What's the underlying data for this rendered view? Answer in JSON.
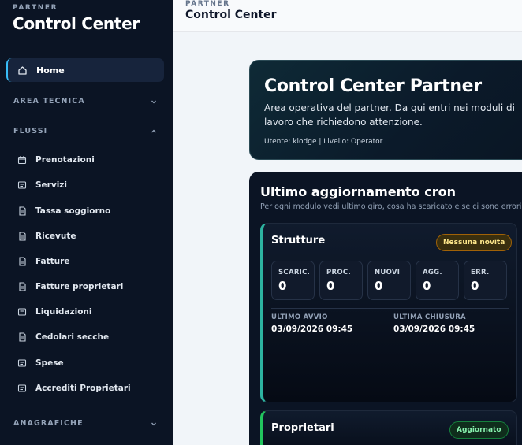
{
  "sidebar": {
    "kicker": "PARTNER",
    "title": "Control Center",
    "home": "Home",
    "sections": {
      "tecnica": "AREA TECNICA",
      "flussi": "FLUSSI",
      "anagrafiche": "ANAGRAFICHE"
    },
    "items": [
      {
        "label": "Prenotazioni",
        "icon": "calendar-icon"
      },
      {
        "label": "Servizi",
        "icon": "receipt-icon"
      },
      {
        "label": "Tassa soggiorno",
        "icon": "document-icon"
      },
      {
        "label": "Ricevute",
        "icon": "document-icon"
      },
      {
        "label": "Fatture",
        "icon": "document-icon"
      },
      {
        "label": "Fatture proprietari",
        "icon": "document-icon"
      },
      {
        "label": "Liquidazioni",
        "icon": "receipt-icon"
      },
      {
        "label": "Cedolari secche",
        "icon": "document-icon"
      },
      {
        "label": "Spese",
        "icon": "receipt-icon"
      },
      {
        "label": "Accrediti Proprietari",
        "icon": "receipt-icon"
      }
    ]
  },
  "header": {
    "kicker": "PARTNER",
    "title": "Control Center"
  },
  "hero": {
    "title": "Control Center Partner",
    "description": "Area operativa del partner. Da qui entri nei moduli di lavoro che richiedono attenzione.",
    "meta": "Utente: klodge | Livello: Operator"
  },
  "cron": {
    "title": "Ultimo aggiornamento cron",
    "subtitle": "Per ogni modulo vedi ultimo giro, cosa ha scaricato e se ci sono errori.",
    "modules": [
      {
        "name": "Strutture",
        "badge": "Nessuna novita",
        "stats": [
          {
            "label": "SCARIC.",
            "value": "0"
          },
          {
            "label": "PROC.",
            "value": "0"
          },
          {
            "label": "NUOVI",
            "value": "0"
          },
          {
            "label": "AGG.",
            "value": "0"
          },
          {
            "label": "ERR.",
            "value": "0"
          }
        ],
        "last_start_label": "ULTIMO AVVIO",
        "last_start": "03/09/2026 09:45",
        "last_end_label": "ULTIMA CHIUSURA",
        "last_end": "03/09/2026 09:45"
      },
      {
        "name": "Proprietari",
        "badge": "Aggiornato"
      }
    ]
  },
  "colors": {
    "sidebar_bg": "#0b1424",
    "accent_teal": "#2db3a0",
    "accent_green": "#22c55e",
    "badge_yellow": "#fde68a"
  }
}
